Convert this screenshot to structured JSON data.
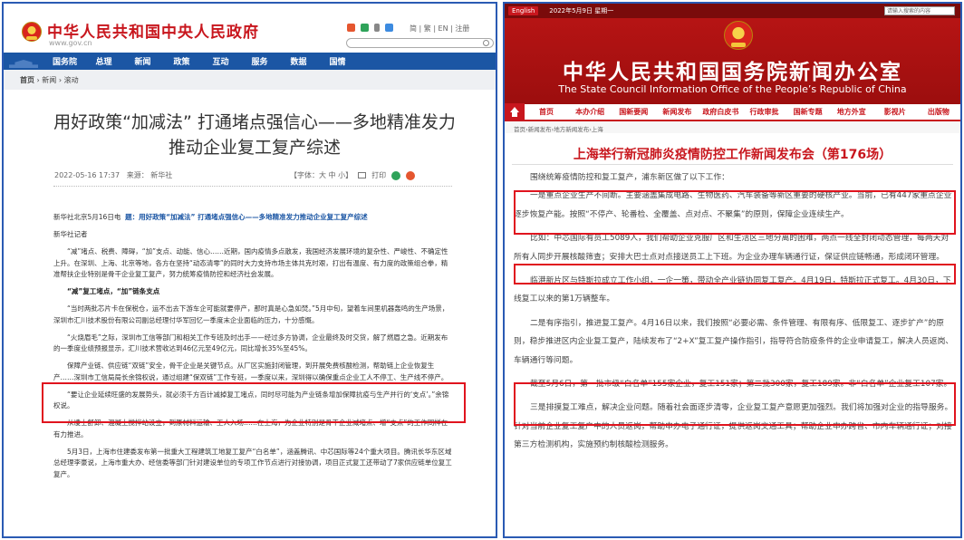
{
  "left": {
    "site_name": "中华人民共和国中央人民政府",
    "site_url": "www.gov.cn",
    "header_links": "简 | 繁 | EN | 注册",
    "nav": [
      "国务院",
      "总理",
      "新闻",
      "政策",
      "互动",
      "服务",
      "数据",
      "国情"
    ],
    "breadcrumb": {
      "home": "首页",
      "sep": "›",
      "section": "新闻",
      "sub": "滚动"
    },
    "article": {
      "title": "用好政策“加减法” 打通堵点强信心——多地精准发力推动企业复工复产综述",
      "date": "2022-05-16 17:37",
      "source": "来源： 新华社",
      "font_size": "【字体：大 中 小】",
      "print": "打印",
      "paragraphs": [
        {
          "lead": "新华社北京5月16日电",
          "lead_title": "题：用好政策“加减法” 打通堵点强信心——多地精准发力推动企业复工复产综述",
          "text": ""
        },
        {
          "text": "新华社记者"
        },
        {
          "text": "“减”堵点、税费、障碍，“加”支点、动能、信心……近期，国内疫情多点散发，我国经济发展环境的复杂性、严峻性、不确定性上升。在深圳、上海、北京等地，各方在坚持“动态清零”的同时大力支持市场主体共克时艰，打出有温度、有力度的政策组合拳，精准帮扶企业特别是骨干企业复工复产，努力统筹疫情防控和经济社会发展。"
        },
        {
          "bold": "“减”复工堵点，“加”链条支点"
        },
        {
          "text": "“当时两批芯片卡在保税仓，运不出去下游车企可能就要停产，那时真是心急如焚。”5月中旬，望着车间里机器轰鸣的生产场景，深圳市汇川技术股份有限公司副总经理付华军回忆一季度末企业面临的压力，十分感慨。"
        },
        {
          "text": "“火烧眉毛”之际，深圳市工信等部门和相关工作专班及时出手——经过多方协调，企业最终及时交货，解了燃眉之急。近期发布的一季度业绩预报显示，汇川技术营收达到46亿元至49亿元，同比增长35%至45%。"
        },
        {
          "text": "保障产业链、供应链“双链”安全，骨干企业是关键节点。从厂区实施封闭管理，到开展免费核酸检测，帮助链上企业恢复生产……深圳市工信局局长余锦权说，通过组建“保双链”工作专班，一季度以来，深圳得以确保重点企业工人不停工、生产线不停产。"
        },
        {
          "text": "“要让企业延续旺盛的发展势头，就必须千方百计减掉复工堵点，同时尽可能为产业链条增加保障抗疫与生产并行的‘支点’。”余锦权说。"
        },
        {
          "text": "从凌士舒卸、混凝土搅拌站设立，到原材料运输、工人入场……在上海，为企业特别是骨干企业减堵点、增“支点”的工作同样在有力推进。"
        },
        {
          "text": "5月3日，上海市住建委发布第一批重大工程建筑工地复工复产“白名单”，涵盖腾讯、中芯国际等24个重大项目。腾讯长华东区域总经理李豪说，上海市重大办、经信委等部门针对建设单位的专项工作节点进行对接协调，项目正式复工还带动了7家供应链单位复工复产。"
        }
      ]
    }
  },
  "right": {
    "top_bar": {
      "lang": "English",
      "date": "2022年5月9日 星期一",
      "search_placeholder": "请输入搜索的内容"
    },
    "site_name_cn": "中华人民共和国国务院新闻办公室",
    "site_name_en": "The State Council Information Office of the People’s Republic of China",
    "nav": [
      "首页",
      "本办介绍",
      "国新要闻",
      "新闻发布",
      "政府白皮书",
      "行政审批",
      "国新专题",
      "地方外宣",
      "影视片",
      "出版物"
    ],
    "breadcrumb": "首页›新闻发布›地方新闻发布›上海",
    "title": "上海举行新冠肺炎疫情防控工作新闻发布会（第176场）",
    "paragraphs": [
      "围绕统筹疫情防控和复工复产，浦东新区做了以下工作：",
      "一是重点企业生产不间断。主要涵盖集成电路、生物医药、汽车装备等新区重要的硬核产业。当前，已有447家重点企业逐步恢复产能。按照“不停产、轮番检、全覆盖、点对点、不聚集”的原则，保障企业连续生产。",
      "比如：中芯国际有员工5089人，我们帮助企业克服厂区和生活区三地分离的困难，两点一线全封闭动态管理，每两天对所有人同步开展核酸筛查；安排大巴士点对点接送员工上下班。为企业办理车辆通行证，保证供应链畅通，形成闭环管理。",
      "临港新片区与特斯拉成立工作小组，一企一策，带动全产业链协同复工复产。4月19日，特斯拉正式复工。4月30日，下线复工以来的第1万辆整车。",
      "二是有序指引，推进复工复产。4月16日以来，我们按照“必要必需、条件管理、有限有序、低限复工、逐步扩产”的原则，稳步推进区内企业复工复产，陆续发布了“2+X”复工复产操作指引，指导符合防疫条件的企业申请复工，解决人员返岗、车辆通行等问题。",
      "截至5月6日，第一批市级“白名单”155家企业，复工151家；第二批300家，复工189家。非“白名单”企业复工107家。",
      "三是排摸复工难点，解决企业问题。随着社会面逐步清零，企业复工复产意愿更加强烈。我们将加强对企业的指导服务。针对当前企业复工复产中的人员返岗，帮助申办电子通行证，提供返岗交通工具；帮助企业申办跨省、市内车辆通行证；对接第三方检测机构，实施预约制核酸检测服务。"
    ]
  },
  "colors": {
    "panel_border": "#2a5ab3",
    "highlight": "#e0141e",
    "gov_blue": "#1b56a4",
    "scio_red": "#b61414"
  }
}
